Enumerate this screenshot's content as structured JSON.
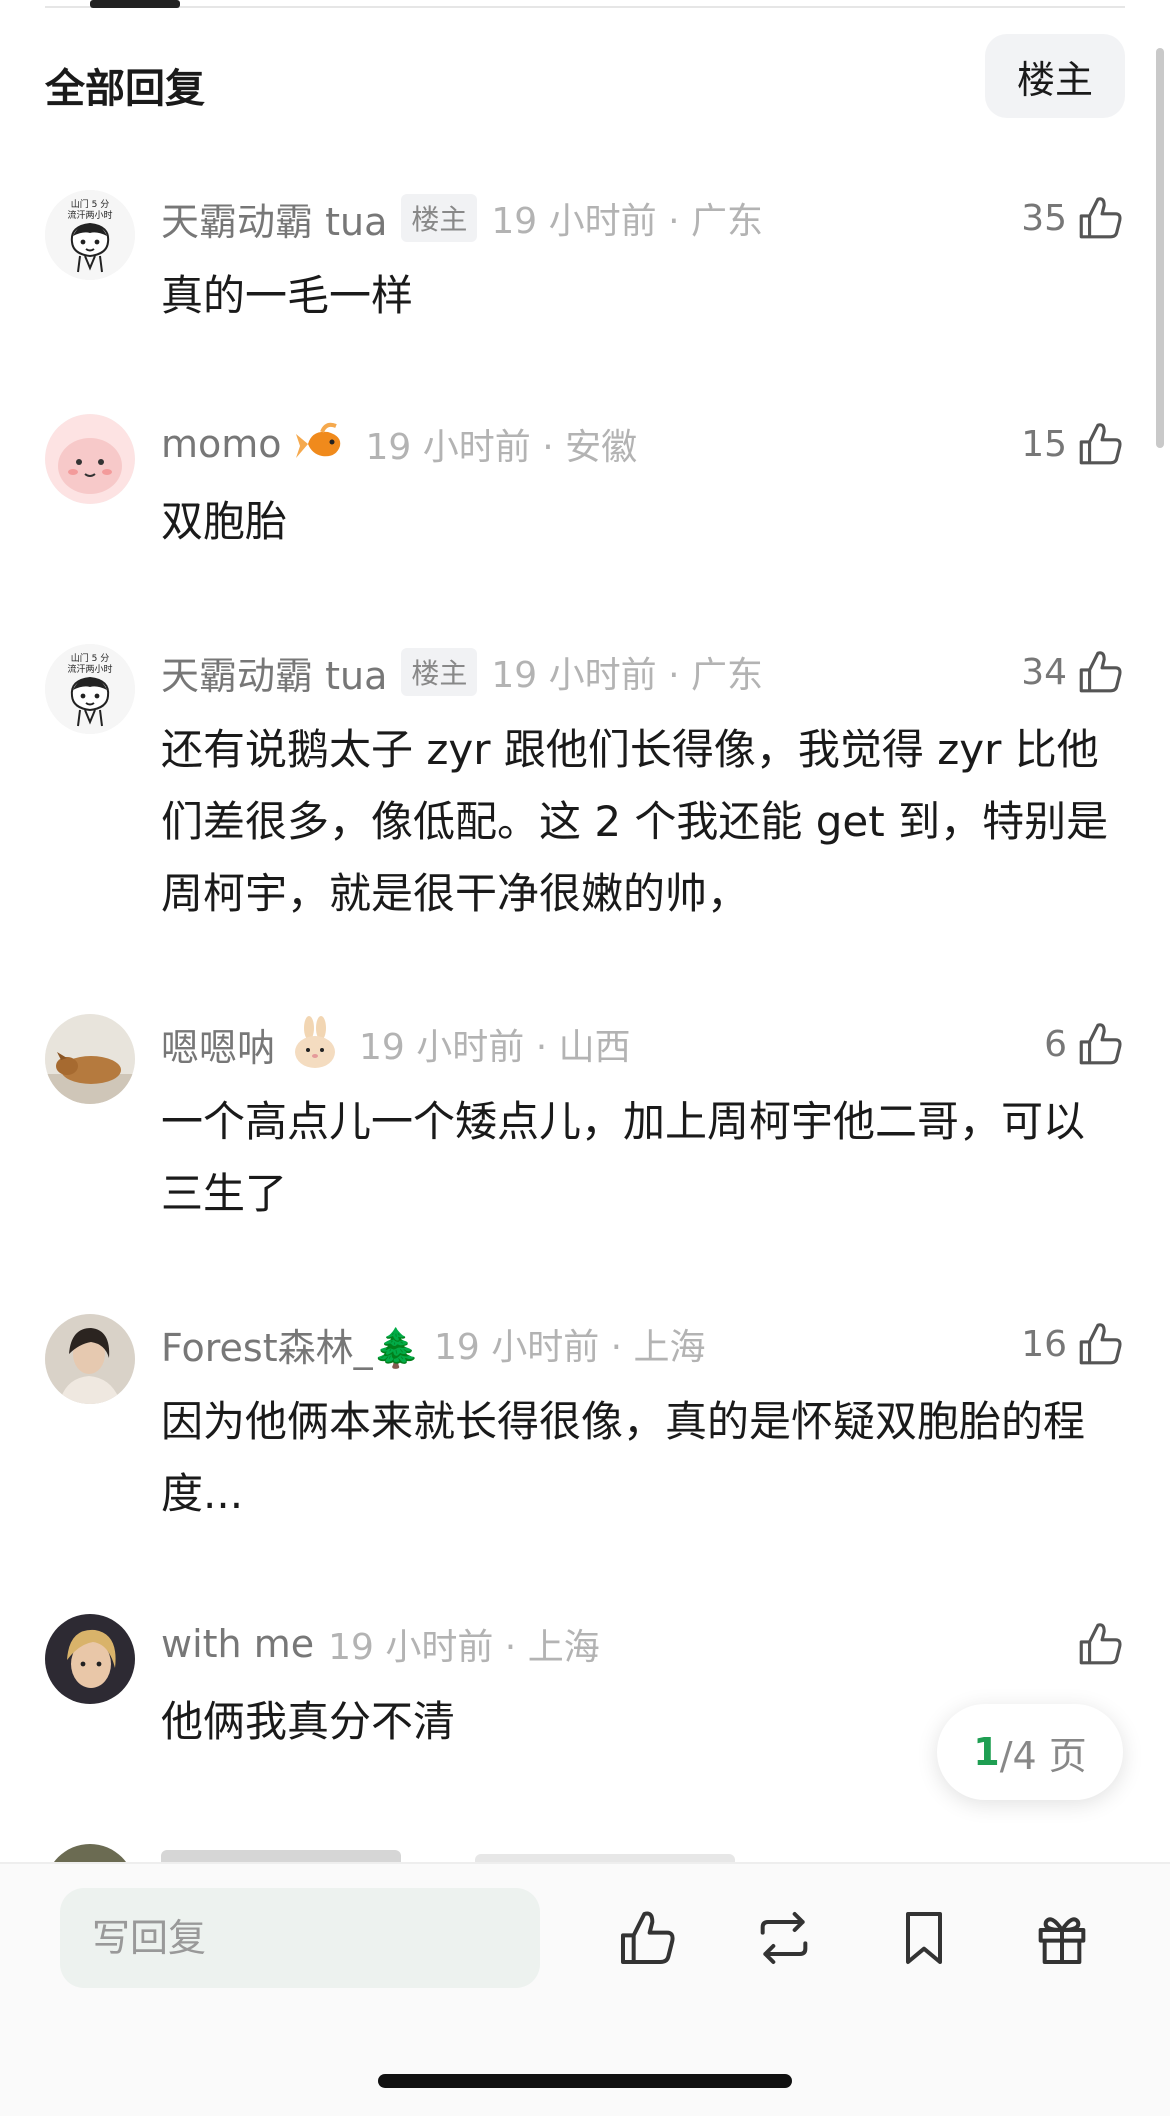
{
  "header": {
    "title": "全部回复",
    "op_filter_label": "楼主"
  },
  "comments": [
    {
      "username": "天霸动霸 tua",
      "op_badge": "楼主",
      "time_location": "19 小时前 · 广东",
      "likes": "35",
      "text": "真的一毛一样"
    },
    {
      "username": "momo",
      "badge_icon": "goldfish-emoji",
      "time_location": "19 小时前 · 安徽",
      "likes": "15",
      "text": "双胞胎"
    },
    {
      "username": "天霸动霸 tua",
      "op_badge": "楼主",
      "time_location": "19 小时前 · 广东",
      "likes": "34",
      "text": "还有说鹅太子 zyr 跟他们长得像，我觉得 zyr 比他们差很多，像低配。这 2 个我还能 get 到，特别是周柯宇，就是很干净很嫩的帅，"
    },
    {
      "username": "嗯嗯呐",
      "badge_icon": "rabbit-emoji",
      "time_location": "19 小时前 · 山西",
      "likes": "6",
      "text": "一个高点儿一个矮点儿，加上周柯宇他二哥，可以三生了"
    },
    {
      "username": "Forest森林_🌲",
      "time_location": "19 小时前 · 上海",
      "likes": "16",
      "text": "因为他俩本来就长得很像，真的是怀疑双胞胎的程度..."
    },
    {
      "username": "with me",
      "time_location": "19 小时前 · 上海",
      "likes": "",
      "text": "他俩我真分不清"
    }
  ],
  "avatar_text": {
    "line1": "山门 5 分",
    "line2": "流汗两小时"
  },
  "pagination": {
    "current": "1",
    "total": "/4 页"
  },
  "bottom_bar": {
    "reply_placeholder": "写回复",
    "icons": [
      "thumbs-up-icon",
      "repost-icon",
      "bookmark-icon",
      "gift-icon"
    ]
  },
  "colors": {
    "accent_green": "#1e9e52",
    "meta_gray": "#b3b3b3",
    "input_bg": "#edf2ef"
  }
}
